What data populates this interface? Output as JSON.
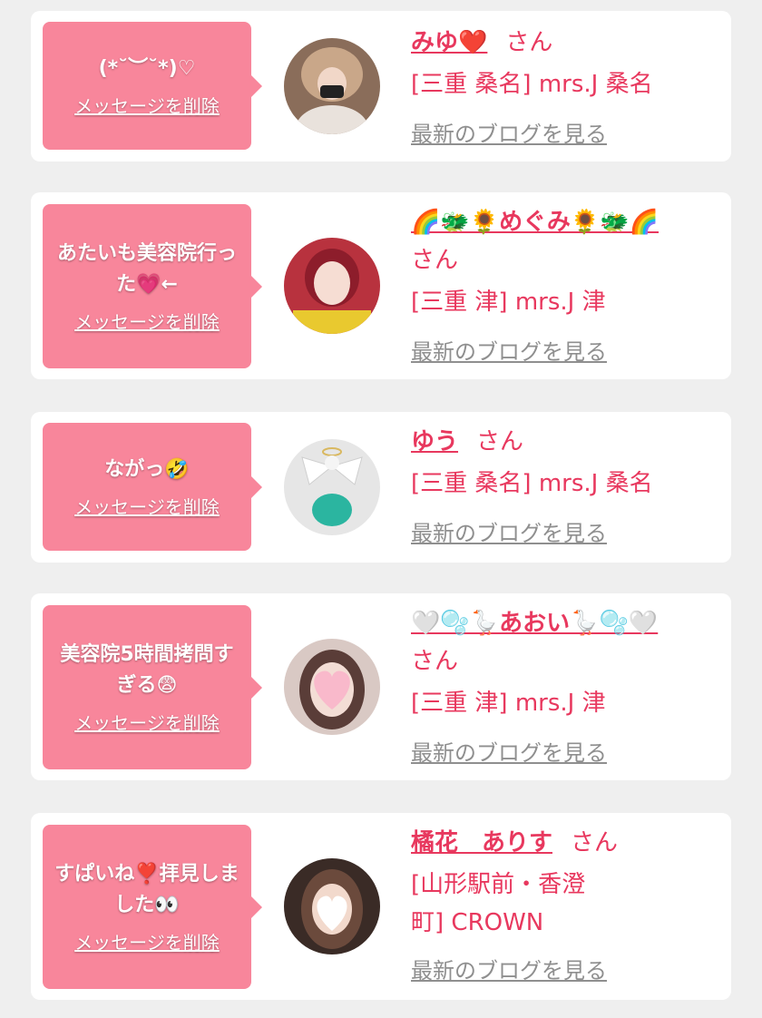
{
  "messages": [
    {
      "bubble_text": "(*˘︶˘*)♡",
      "delete_label": "メッセージを削除",
      "name": "みゆ❤️",
      "honorific": "さん",
      "shop": "[三重 桑名] mrs.J 桑名",
      "blog_label": "最新のブログを見る"
    },
    {
      "bubble_text": "あたいも美容院行った💗←",
      "delete_label": "メッセージを削除",
      "name": "🌈🐲🌻めぐみ🌻🐲🌈",
      "honorific": "さん",
      "shop": "[三重 津] mrs.J 津",
      "blog_label": "最新のブログを見る"
    },
    {
      "bubble_text": "ながっ🤣",
      "delete_label": "メッセージを削除",
      "name": "ゆう",
      "honorific": "さん",
      "shop": "[三重 桑名] mrs.J 桑名",
      "blog_label": "最新のブログを見る"
    },
    {
      "bubble_text": "美容院5時間拷問すぎる😨",
      "delete_label": "メッセージを削除",
      "name": "🤍🫧🪿あおい🪿🫧🤍",
      "honorific": "さん",
      "shop": "[三重 津] mrs.J 津",
      "blog_label": "最新のブログを見る"
    },
    {
      "bubble_text": "すぱいね❣️拝見しました👀",
      "delete_label": "メッセージを削除",
      "name": "橘花　ありす",
      "honorific": "さん",
      "shop": "[山形駅前・香澄町] CROWN",
      "blog_label": "最新のブログを見る"
    }
  ],
  "colors": {
    "page_bg": "#efefef",
    "card_bg": "#ffffff",
    "bubble_bg": "#f8869b",
    "accent": "#e8385e",
    "link_gray": "#8f8f8f"
  }
}
